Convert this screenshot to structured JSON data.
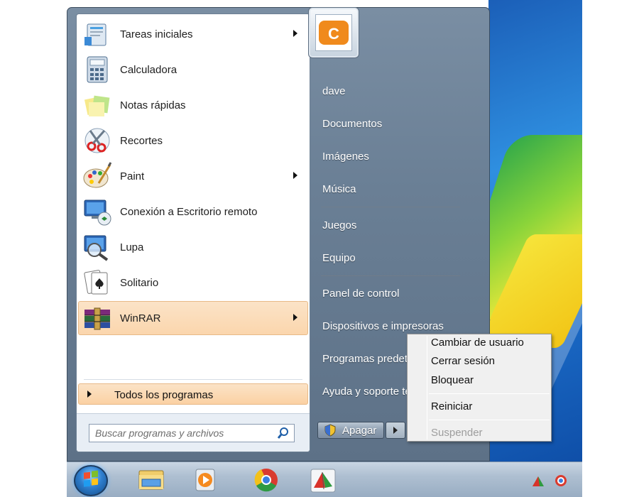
{
  "start_menu": {
    "programs": [
      {
        "label": "Tareas iniciales",
        "icon": "getting-started-icon",
        "has_submenu": true
      },
      {
        "label": "Calculadora",
        "icon": "calculator-icon",
        "has_submenu": false
      },
      {
        "label": "Notas rápidas",
        "icon": "sticky-notes-icon",
        "has_submenu": false
      },
      {
        "label": "Recortes",
        "icon": "snipping-tool-icon",
        "has_submenu": false
      },
      {
        "label": "Paint",
        "icon": "paint-icon",
        "has_submenu": true
      },
      {
        "label": "Conexión a Escritorio remoto",
        "icon": "remote-desktop-icon",
        "has_submenu": false
      },
      {
        "label": "Lupa",
        "icon": "magnifier-icon",
        "has_submenu": false
      },
      {
        "label": "Solitario",
        "icon": "solitaire-icon",
        "has_submenu": false
      },
      {
        "label": "WinRAR",
        "icon": "winrar-icon",
        "has_submenu": true
      }
    ],
    "all_programs_label": "Todos los programas",
    "search_placeholder": "Buscar programas y archivos",
    "right_items": {
      "user": "dave",
      "documents": "Documentos",
      "pictures": "Imágenes",
      "music": "Música",
      "games": "Juegos",
      "computer": "Equipo",
      "control_panel": "Panel de control",
      "devices": "Dispositivos e impresoras",
      "default_programs": "Programas predeterminados",
      "help": "Ayuda y soporte técnico"
    },
    "shutdown_label": "Apagar"
  },
  "context_menu": {
    "switch_user": "Cambiar de usuario",
    "log_off": "Cerrar sesión",
    "lock": "Bloquear",
    "restart": "Reiniciar",
    "sleep": "Suspender"
  },
  "taskbar": {
    "pinned": [
      "file-explorer-icon",
      "media-player-icon",
      "chrome-icon",
      "winrar-icon"
    ]
  },
  "colors": {
    "highlight": "#fbd6ad",
    "menu_right_pane": "#6a7f95",
    "context_menu_bg": "#f0f0f0"
  }
}
